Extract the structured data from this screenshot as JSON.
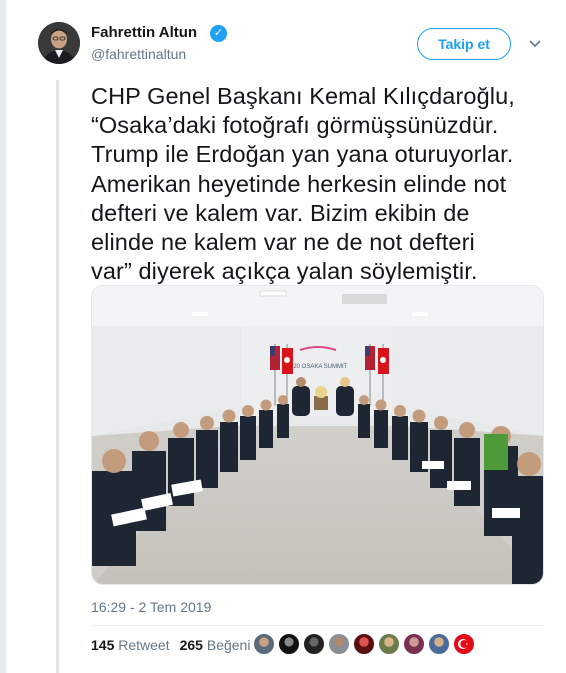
{
  "profile": {
    "name": "Fahrettin Altun",
    "handle": "@fahrettinaltun",
    "verified_icon": "verified-badge-icon"
  },
  "actions": {
    "follow_label": "Takip et",
    "more_icon": "chevron-down-icon"
  },
  "tweet": {
    "text": "CHP Genel Başkanı Kemal Kılıçdaroğlu,\n“Osaka’daki fotoğrafı görmüşsünüzdür.\nTrump ile Erdoğan yan yana oturuyorlar.\nAmerikan heyetinde herkesin elinde not\ndefteri ve kalem var. Bizim ekibin de\nelinde ne kalem var ne de not defteri\nvar” diyerek açıkça yalan söylemiştir.",
    "photo_banner": "G20 OSAKA SUMMIT",
    "timestamp": "16:29 - 2 Tem 2019"
  },
  "stats": {
    "retweet_count": "145",
    "retweet_label": "Retweet",
    "like_count": "265",
    "like_label": "Beğeni"
  },
  "colors": {
    "accent": "#1da1f2",
    "text": "#14171a",
    "secondary": "#657786"
  }
}
